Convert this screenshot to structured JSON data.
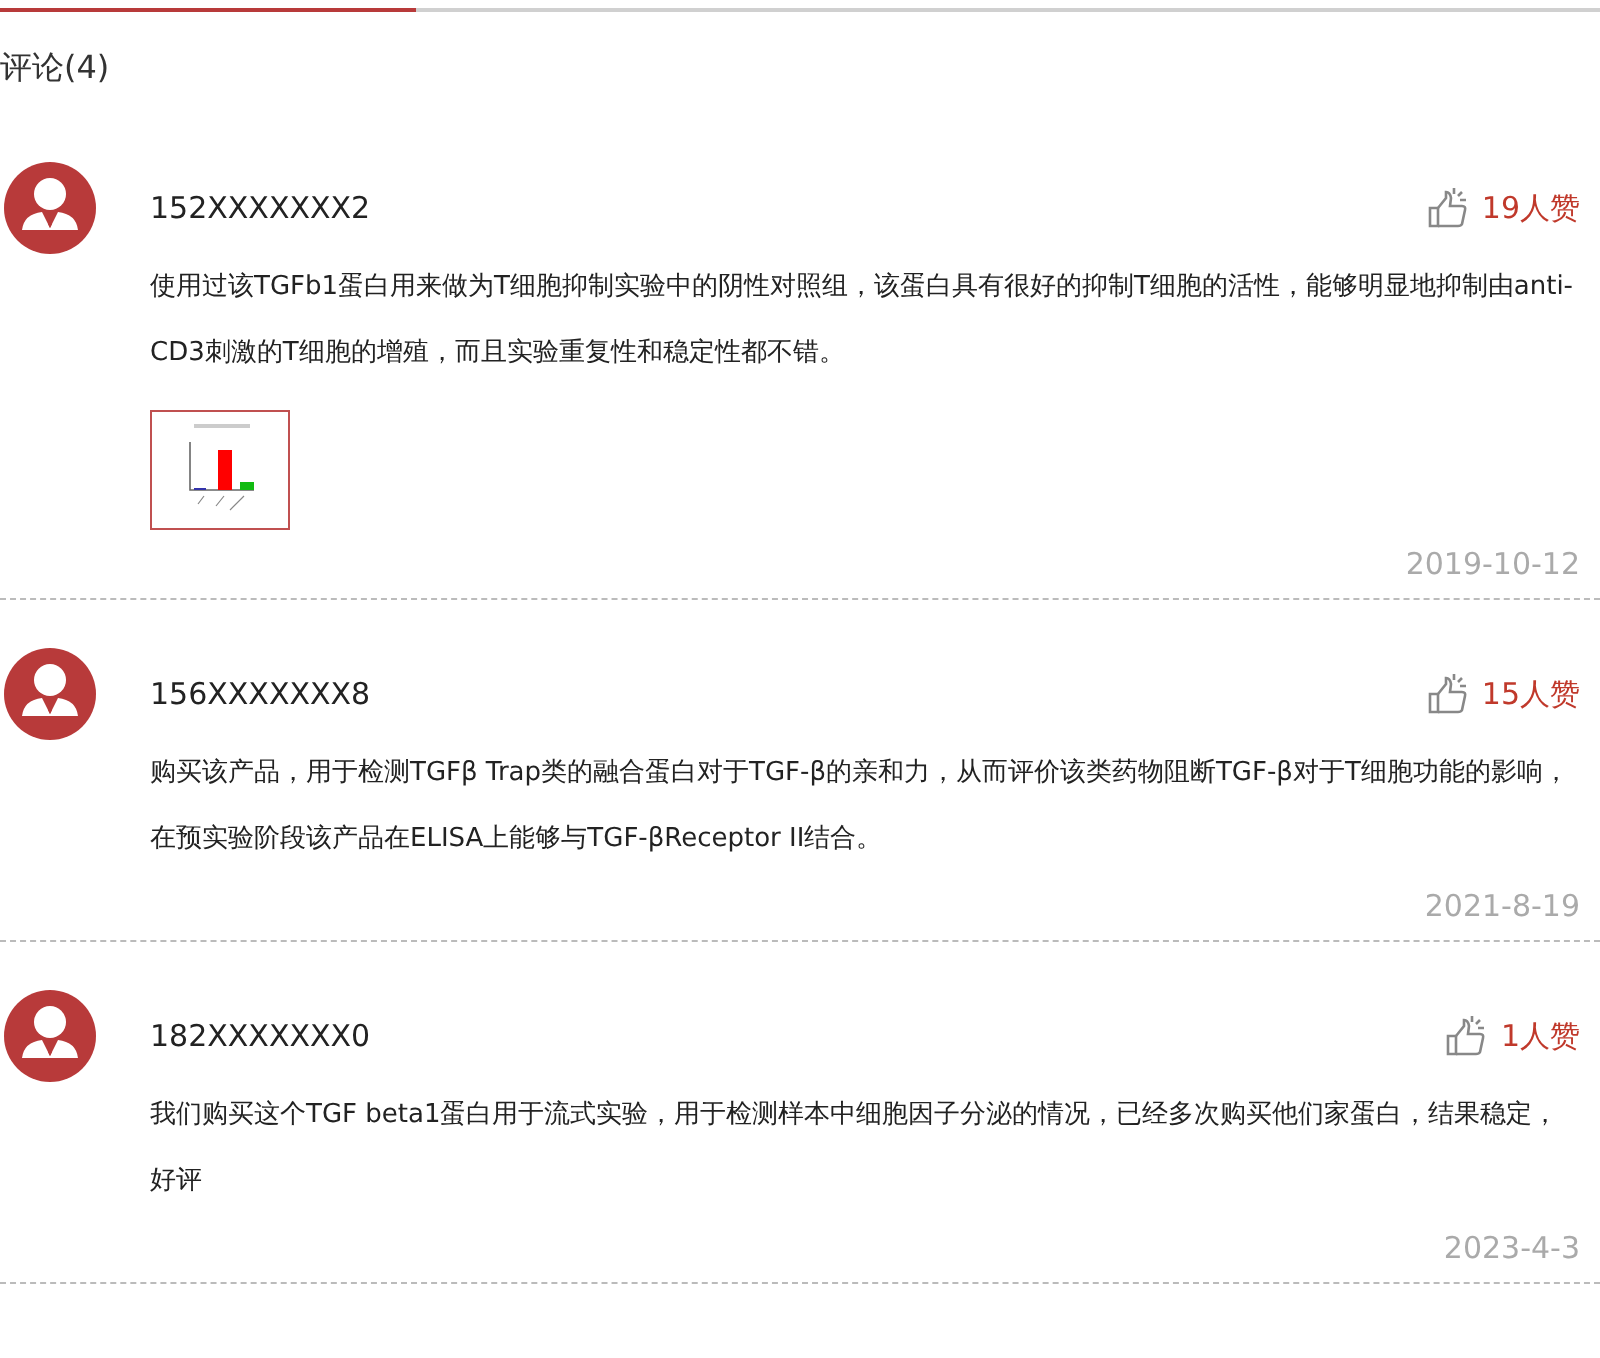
{
  "heading": "评论(4)",
  "comments": [
    {
      "user": "152XXXXXXX2",
      "likes": "19人赞",
      "text": "使用过该TGFb1蛋白用来做为T细胞抑制实验中的阴性对照组，该蛋白具有很好的抑制T细胞的活性，能够明显地抑制由anti-CD3刺激的T细胞的增殖，而且实验重复性和稳定性都不错。",
      "date": "2019-10-12"
    },
    {
      "user": "156XXXXXXX8",
      "likes": "15人赞",
      "text": "购买该产品，用于检测TGFβ Trap类的融合蛋白对于TGF-β的亲和力，从而评价该类药物阻断TGF-β对于T细胞功能的影响，在预实验阶段该产品在ELISA上能够与TGF-βReceptor II结合。",
      "date": "2021-8-19"
    },
    {
      "user": "182XXXXXXX0",
      "likes": "1人赞",
      "text": "我们购买这个TGF beta1蛋白用于流式实验，用于检测样本中细胞因子分泌的情况，已经多次购买他们家蛋白，结果稳定，好评",
      "date": "2023-4-3"
    }
  ]
}
